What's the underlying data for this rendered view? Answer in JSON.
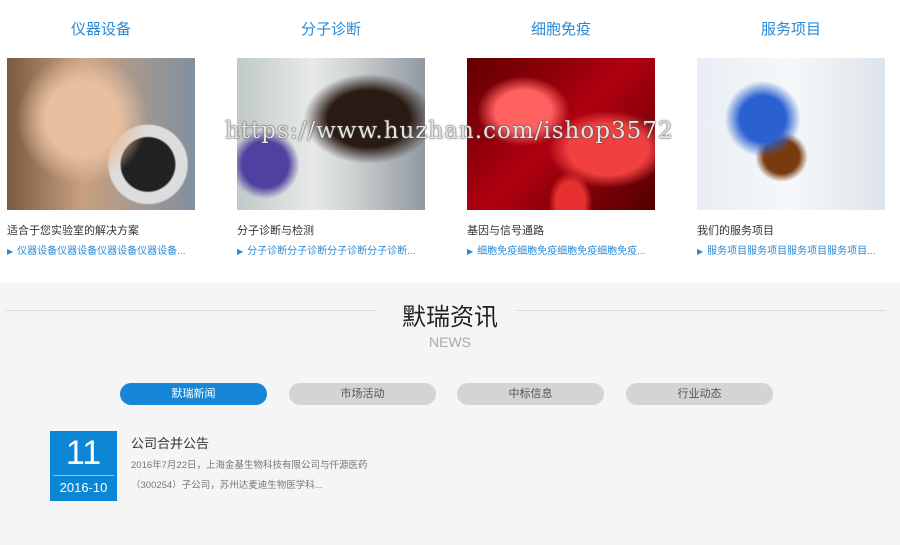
{
  "categories": [
    {
      "title": "仪器设备",
      "subtitle": "适合于您实验室的解决方案",
      "link": "仪器设备仪器设备仪器设备仪器设备..."
    },
    {
      "title": "分子诊断",
      "subtitle": "分子诊断与检测",
      "link": "分子诊断分子诊断分子诊断分子诊断..."
    },
    {
      "title": "细胞免疫",
      "subtitle": "基因与信号通路",
      "link": "细胞免疫细胞免疫细胞免疫细胞免疫..."
    },
    {
      "title": "服务项目",
      "subtitle": "我们的服务项目",
      "link": "服务项目服务项目服务项目服务项目..."
    }
  ],
  "link_arrow": "▶",
  "watermark": "https://www.huzhan.com/ishop3572",
  "news": {
    "heading": "默瑞资讯",
    "heading_en": "NEWS",
    "tabs": [
      "默瑞新闻",
      "市场活动",
      "中标信息",
      "行业动态"
    ],
    "items": [
      {
        "day": "11",
        "year_month": "2016-10",
        "title": "公司合并公告",
        "desc": "2016年7月22日，上海金基生物科技有限公司与仟源医药（300254）子公司，苏州达麦迪生物医学科..."
      }
    ]
  },
  "colors": {
    "accent": "#1686d6",
    "link": "#2a8ad6"
  }
}
